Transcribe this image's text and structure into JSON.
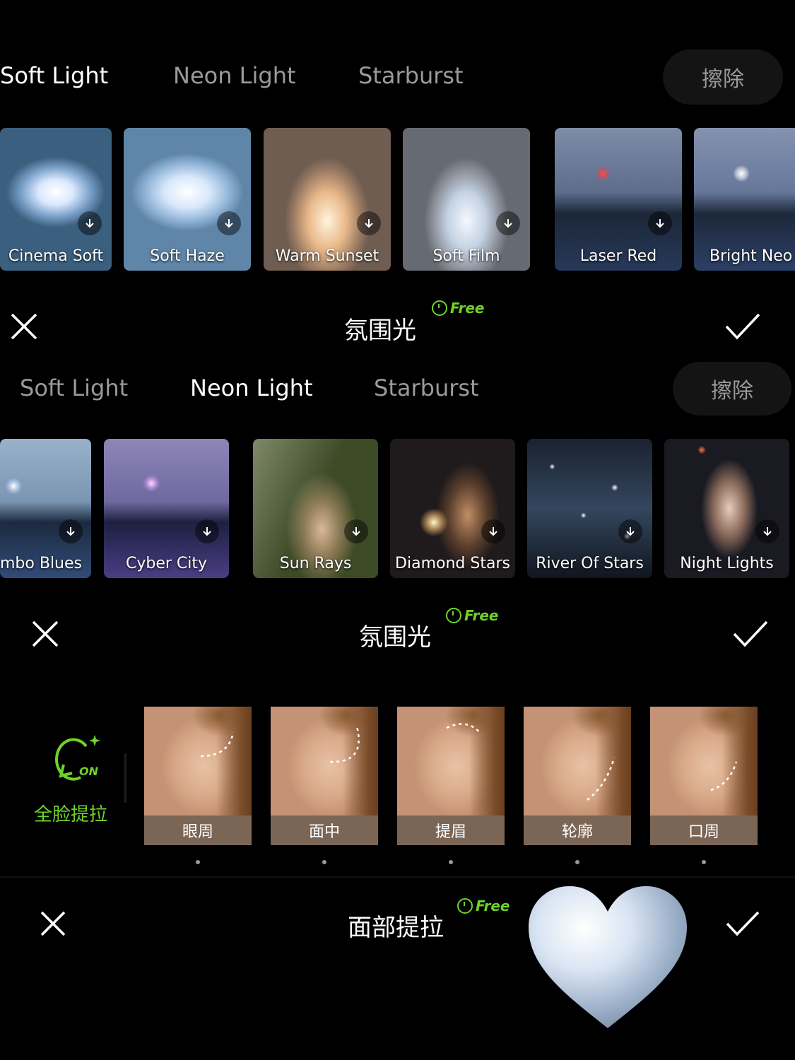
{
  "panel1": {
    "tabs": [
      "Soft Light",
      "Neon Light",
      "Starburst"
    ],
    "erase": "擦除",
    "items": [
      {
        "label": "Cinema Soft"
      },
      {
        "label": "Soft Haze"
      },
      {
        "label": "Warm Sunset"
      },
      {
        "label": "Soft Film"
      },
      {
        "label": "Laser Red"
      },
      {
        "label": "Bright Neo"
      }
    ],
    "title": "氛围光",
    "free": "Free"
  },
  "panel2": {
    "tabs": [
      "Soft Light",
      "Neon Light",
      "Starburst"
    ],
    "erase": "擦除",
    "items": [
      {
        "label": "mbo Blues"
      },
      {
        "label": "Cyber City"
      },
      {
        "label": "Sun Rays"
      },
      {
        "label": "Diamond Stars"
      },
      {
        "label": "River Of Stars"
      },
      {
        "label": "Night Lights"
      }
    ],
    "title": "氛围光",
    "free": "Free"
  },
  "panel3": {
    "toggle_badge": "ON",
    "toggle_label": "全脸提拉",
    "items": [
      {
        "label": "眼周"
      },
      {
        "label": "面中"
      },
      {
        "label": "提眉"
      },
      {
        "label": "轮廓"
      },
      {
        "label": "口周"
      }
    ],
    "title": "面部提拉",
    "free": "Free"
  },
  "colors": {
    "accent_green": "#6ed22c",
    "background": "#000000"
  }
}
